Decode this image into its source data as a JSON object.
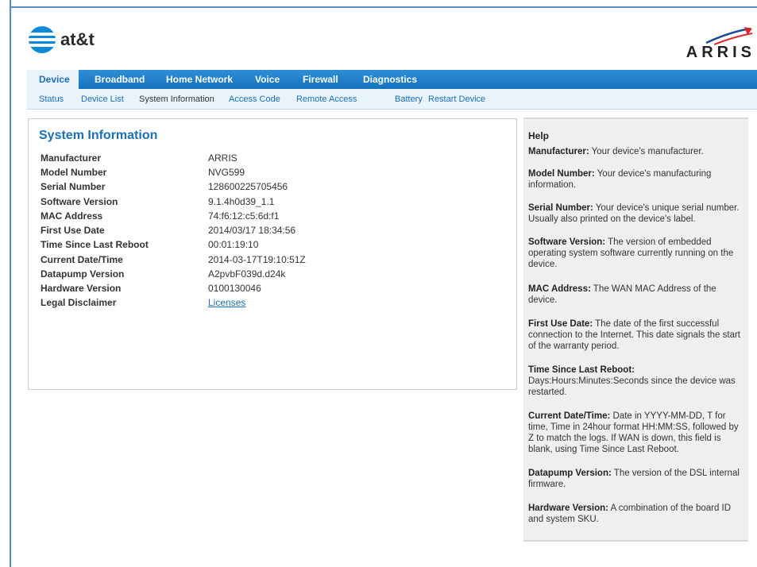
{
  "header": {
    "att_logo_text": "at&t",
    "arris_logo_text": "ARRIS"
  },
  "tabs": [
    {
      "label": "Device",
      "active": true
    },
    {
      "label": "Broadband"
    },
    {
      "label": "Home Network"
    },
    {
      "label": "Voice"
    },
    {
      "label": "Firewall"
    },
    {
      "label": "Diagnostics"
    }
  ],
  "subtabs": [
    {
      "label": "Status"
    },
    {
      "label": "Device List"
    },
    {
      "label": "System Information",
      "active": true
    },
    {
      "label": "Access Code"
    },
    {
      "label": "Remote Access"
    },
    {
      "label": "Battery"
    },
    {
      "label": "Restart Device"
    }
  ],
  "main": {
    "title": "System Information",
    "rows": [
      {
        "label": "Manufacturer",
        "value": "ARRIS"
      },
      {
        "label": "Model Number",
        "value": "NVG599"
      },
      {
        "label": "Serial Number",
        "value": "128600225705456"
      },
      {
        "label": "Software Version",
        "value": "9.1.4h0d39_1.1"
      },
      {
        "label": "MAC Address",
        "value": "74:f6:12:c5:6d:f1"
      },
      {
        "label": "First Use Date",
        "value": "2014/03/17 18:34:56"
      },
      {
        "label": "Time Since Last Reboot",
        "value": "00:01:19:10"
      },
      {
        "label": "Current Date/Time",
        "value": "2014-03-17T19:10:51Z"
      },
      {
        "label": "Datapump Version",
        "value": "A2pvbF039d.d24k"
      },
      {
        "label": "Hardware Version",
        "value": "0100130046"
      },
      {
        "label": "Legal Disclaimer",
        "value": "Licenses"
      }
    ]
  },
  "help": {
    "title": "Help",
    "items": [
      {
        "term": "Manufacturer:",
        "text": " Your device's manufacturer."
      },
      {
        "term": "Model Number:",
        "text": " Your device's manufacturing information."
      },
      {
        "term": "Serial Number:",
        "text": " Your device's unique serial number. Usually also printed on the device's label."
      },
      {
        "term": "Software Version:",
        "text": " The version of embedded operating system software currently running on the device."
      },
      {
        "term": "MAC Address:",
        "text": " The WAN MAC Address of the device."
      },
      {
        "term": "First Use Date:",
        "text": " The date of the first successful connection to the Internet. This date signals the start of the warranty period."
      },
      {
        "term": "Time Since Last Reboot:",
        "text": " Days:Hours:Minutes:Seconds since the device was restarted."
      },
      {
        "term": "Current Date/Time:",
        "text": " Date in YYYY-MM-DD, T for time, Time in 24hour format HH:MM:SS, followed by Z to match the logs. If WAN is down, this field is blank, using Time Since Last Reboot."
      },
      {
        "term": "Datapump Version:",
        "text": " The version of the DSL internal firmware."
      },
      {
        "term": "Hardware Version:",
        "text": " A combination of the board ID and system SKU."
      }
    ]
  }
}
